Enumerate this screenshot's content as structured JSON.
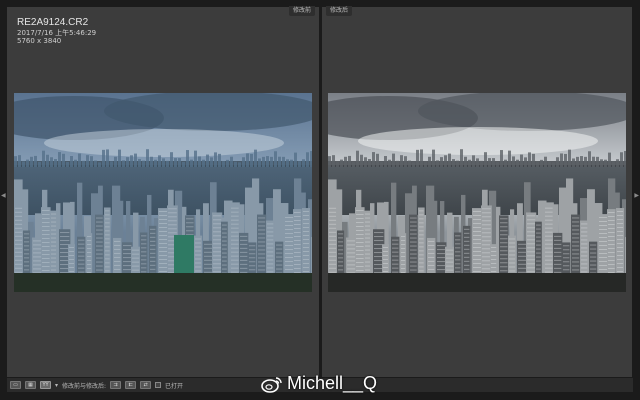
{
  "file": {
    "name": "RE2A9124.CR2",
    "datetime": "2017/7/16 上午5:46:29",
    "dimensions": "5760 x 3840"
  },
  "panels": {
    "before_label": "修改前",
    "after_label": "修改后"
  },
  "toolbar": {
    "view_mode_label": "YY",
    "compare_label": "修改前与修改后:",
    "toggle_label": "已打开"
  },
  "watermark": {
    "text": "Michell__Q"
  },
  "icons": [
    "loupe-view-icon",
    "compare-view-icon",
    "dropdown-arrow-icon",
    "copy-settings-icon",
    "swap-icon",
    "weibo-icon",
    "left-arrow-icon",
    "right-arrow-icon"
  ],
  "colors": {
    "background": "#1b1b1b",
    "panel": "#3c3c3c",
    "toolbar": "#2b2b2b"
  }
}
